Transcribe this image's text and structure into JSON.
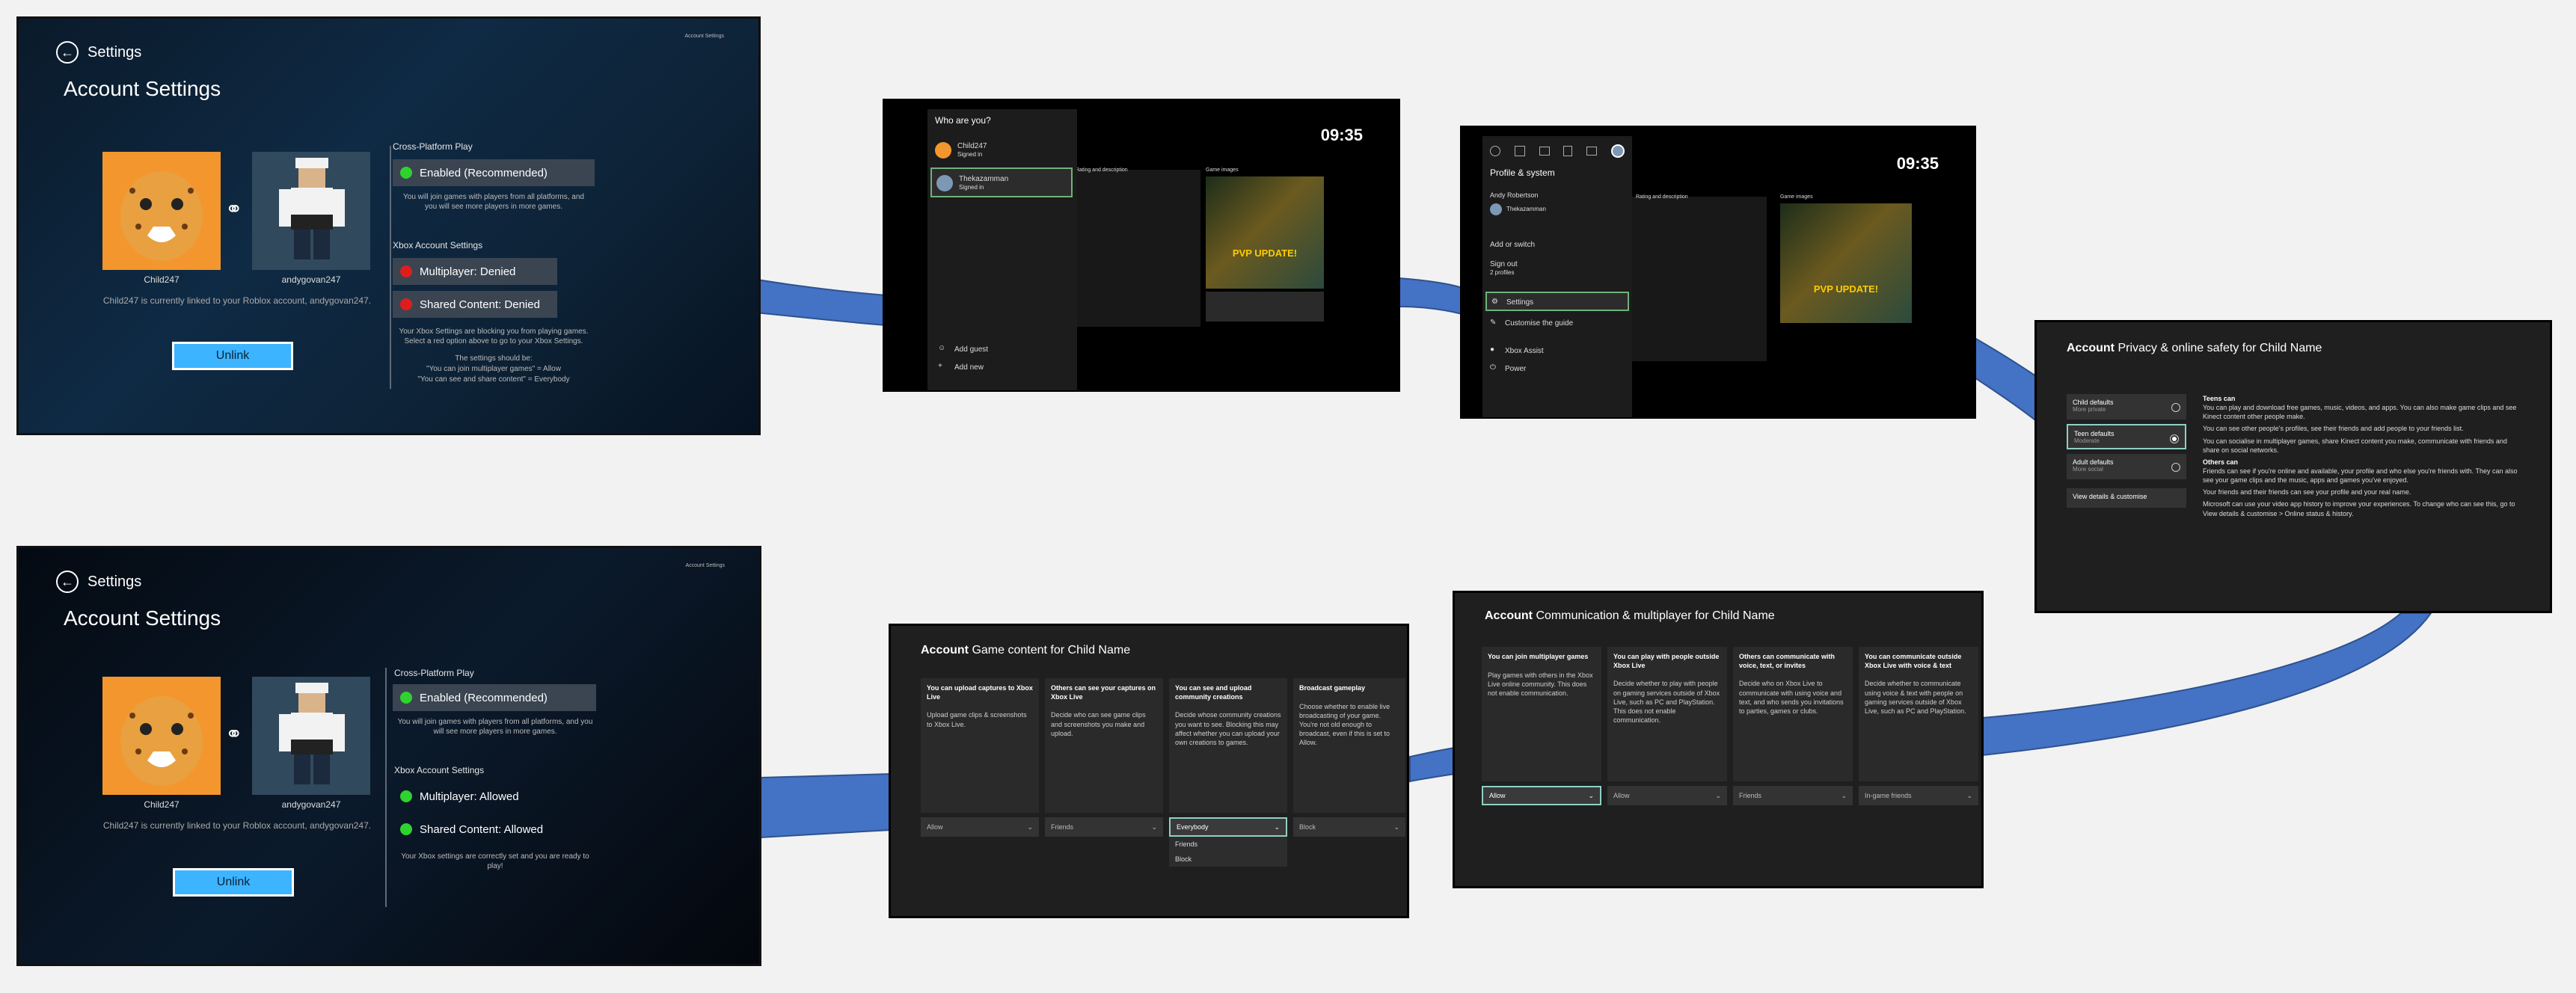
{
  "colors": {
    "arrow": "#4472c4",
    "enabled": "#2ed32e",
    "denied": "#e01d1d",
    "unlink": "#3cb4ff"
  },
  "roblox_before": {
    "back_label": "Settings",
    "corner_text": "Account Settings",
    "title": "Account Settings",
    "user1": "Child247",
    "user2": "andygovan247",
    "linked_text": "Child247 is currently linked to your Roblox account, andygovan247.",
    "unlink": "Unlink",
    "cross_platform_heading": "Cross-Platform Play",
    "cross_platform_option": "Enabled (Recommended)",
    "cross_platform_note": "You will join games with players from all platforms, and you will see more players in more games.",
    "xbox_heading": "Xbox Account Settings",
    "multiplayer": "Multiplayer: Denied",
    "shared": "Shared Content: Denied",
    "blocking_note": "Your Xbox Settings are blocking you from playing games. Select a red option above to go to your Xbox Settings.",
    "should_be": "The settings should be:",
    "should_1": "\"You can join multiplayer games\" = Allow",
    "should_2": "\"You can see and share content\" = Everybody"
  },
  "roblox_after": {
    "back_label": "Settings",
    "corner_text": "Account Settings",
    "title": "Account Settings",
    "user1": "Child247",
    "user2": "andygovan247",
    "linked_text": "Child247 is currently linked to your Roblox account, andygovan247.",
    "unlink": "Unlink",
    "cross_platform_heading": "Cross-Platform Play",
    "cross_platform_option": "Enabled (Recommended)",
    "cross_platform_note": "You will join games with players from all platforms, and you will see more players in more games.",
    "xbox_heading": "Xbox Account Settings",
    "multiplayer": "Multiplayer: Allowed",
    "shared": "Shared Content: Allowed",
    "ok_note": "Your Xbox settings are correctly set and you are ready to play!"
  },
  "who_are_you": {
    "heading": "Who are you?",
    "time": "09:35",
    "profiles": [
      {
        "name": "Child247",
        "status": "Signed in"
      },
      {
        "name": "Thekazamman",
        "status": "Signed in"
      }
    ],
    "add_guest": "Add guest",
    "add_new": "Add new",
    "bg_labels": [
      "Rating and description",
      "Game images"
    ],
    "banner": "PVP UPDATE!"
  },
  "profile_system": {
    "heading": "Profile & system",
    "time": "09:35",
    "user_name": "Andy Robertson",
    "gamertag": "Thekazamman",
    "add_switch": "Add or switch",
    "sign_out": "Sign out",
    "sign_out_sub": "2 profiles",
    "settings": "Settings",
    "customise": "Customise the guide",
    "assist": "Xbox Assist",
    "power": "Power",
    "bg_labels": [
      "Rating and description",
      "Game images"
    ],
    "banner": "PVP UPDATE!"
  },
  "privacy": {
    "title_bold": "Account",
    "title_rest": "Privacy & online safety for Child Name",
    "options": [
      {
        "label": "Child defaults",
        "sub": "More private"
      },
      {
        "label": "Teen defaults",
        "sub": "Moderate"
      },
      {
        "label": "Adult defaults",
        "sub": "More social"
      }
    ],
    "view_details": "View details & customise",
    "teens_can": "Teens can",
    "teens_1": "You can play and download free games, music, videos, and apps. You can also make game clips and see Kinect content other people make.",
    "teens_2": "You can see other people's profiles, see their friends and add people to your friends list.",
    "teens_3": "You can socialise in multiplayer games, share Kinect content you make, communicate with friends and share on social networks.",
    "others_can": "Others can",
    "others_1": "Friends can see if you're online and available, your profile and who else you're friends with. They can also see your game clips and the music, apps and games you've enjoyed.",
    "others_2": "Your friends and their friends can see your profile and your real name.",
    "others_3": "Microsoft can use your video app history to improve your experiences. To change who can see this, go to View details & customise > Online status & history."
  },
  "communication": {
    "title_bold": "Account",
    "title_rest": "Communication & multiplayer for Child Name",
    "columns": [
      {
        "heading": "You can join multiplayer games",
        "text": "Play games with others in the Xbox Live online community. This does not enable communication.",
        "value": "Allow"
      },
      {
        "heading": "You can play with people outside Xbox Live",
        "text": "Decide whether to play with people on gaming services outside of Xbox Live, such as PC and PlayStation. This does not enable communication.",
        "value": "Allow"
      },
      {
        "heading": "Others can communicate with voice, text, or invites",
        "text": "Decide who on Xbox Live to communicate with using voice and text, and who sends you invitations to parties, games or clubs.",
        "value": "Friends"
      },
      {
        "heading": "You can communicate outside Xbox Live with voice & text",
        "text": "Decide whether to communicate using voice & text with people on gaming services outside of Xbox Live, such as PC and PlayStation.",
        "value": "In-game friends"
      }
    ]
  },
  "game_content": {
    "title_bold": "Account",
    "title_rest": "Game content for Child Name",
    "columns": [
      {
        "heading": "You can upload captures to Xbox Live",
        "text": "Upload game clips & screenshots to Xbox Live.",
        "value": "Allow"
      },
      {
        "heading": "Others can see your captures on Xbox Live",
        "text": "Decide who can see game clips and screenshots you make and upload.",
        "value": "Friends"
      },
      {
        "heading": "You can see and upload community creations",
        "text": "Decide whose community creations you want to see. Blocking this may affect whether you can upload your own creations to games.",
        "value": "Everybody"
      },
      {
        "heading": "Broadcast gameplay",
        "text": "Choose whether to enable live broadcasting of your game. You're not old enough to broadcast, even if this is set to Allow.",
        "value": "Block"
      }
    ],
    "dropdown_options": [
      "Friends",
      "Block"
    ]
  }
}
